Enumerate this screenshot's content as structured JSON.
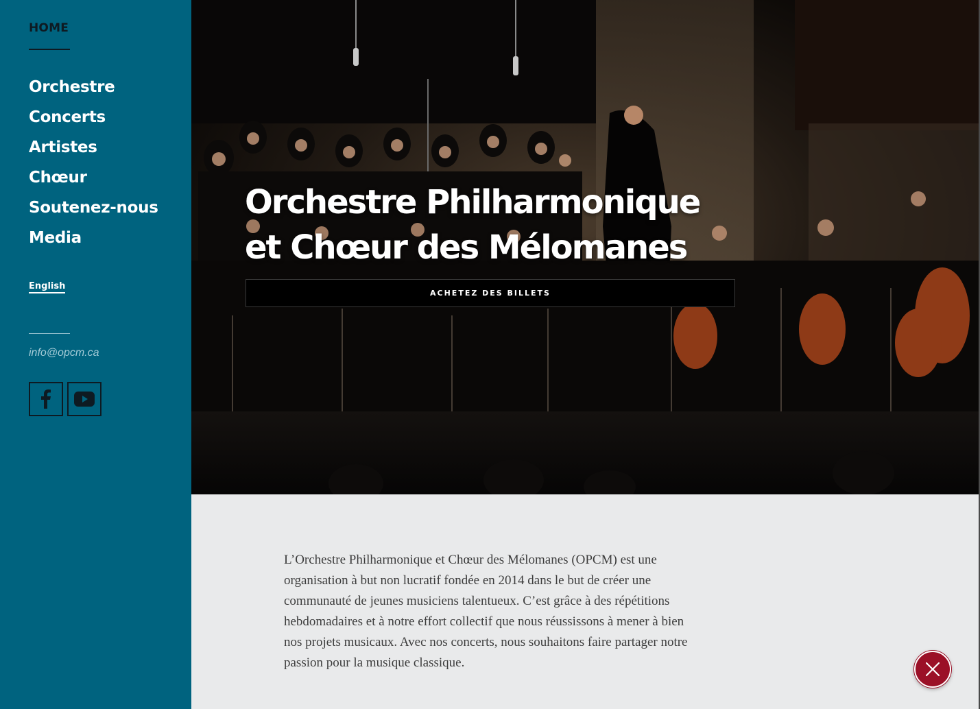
{
  "sidebar": {
    "home_label": "HOME",
    "nav": [
      {
        "label": "Orchestre"
      },
      {
        "label": "Concerts"
      },
      {
        "label": "Artistes"
      },
      {
        "label": "Chœur"
      },
      {
        "label": "Soutenez-nous"
      },
      {
        "label": "Media"
      }
    ],
    "language_label": "English",
    "email": "info@opcm.ca",
    "social": [
      {
        "icon": "facebook-icon"
      },
      {
        "icon": "youtube-icon"
      }
    ]
  },
  "hero": {
    "title_line1": "Orchestre Philharmonique",
    "title_line2": "et Chœur des Mélomanes",
    "cta_label": "ACHETEZ DES BILLETS"
  },
  "intro": {
    "text": "L’Orchestre Philharmonique et Chœur des Mélomanes (OPCM) est une organisation à but non lucratif fondée en 2014 dans le but de créer une communauté de jeunes musiciens talentueux. C’est grâce à des répétitions hebdomadaires et à notre effort collectif que nous réussissons à mener à bien nos projets musicaux. Avec nos concerts, nous souhaitons faire partager notre passion pour la musique classique."
  },
  "close_button": {
    "icon": "close-icon"
  },
  "colors": {
    "sidebar": "#00637f",
    "content_bg": "#e9eaeb",
    "close_button": "#9b1027"
  }
}
